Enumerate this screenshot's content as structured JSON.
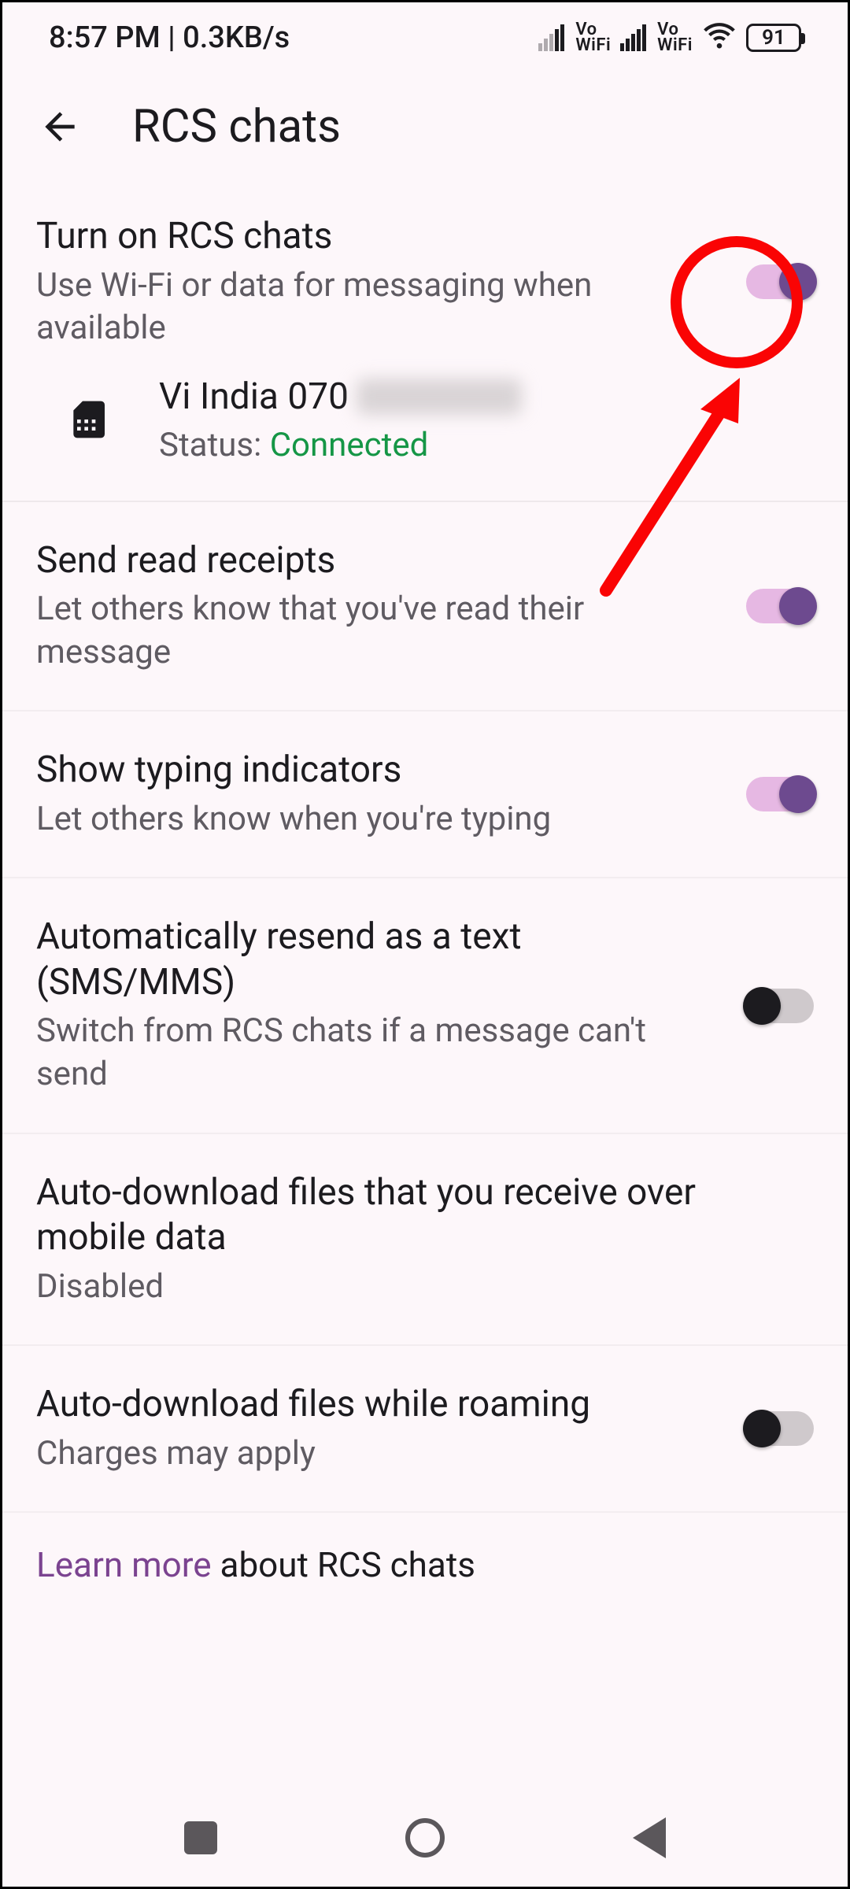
{
  "status_bar": {
    "time": "8:57 PM",
    "speed": "0.3KB/s",
    "vowifi1": "Vo\nWiFi",
    "vowifi2": "Vo\nWiFi",
    "battery": "91"
  },
  "header": {
    "title": "RCS chats"
  },
  "settings": {
    "rcs": {
      "title": "Turn on RCS chats",
      "subtitle": "Use Wi-Fi or data for messaging when available",
      "on": true
    },
    "sim": {
      "name_prefix": "Vi India 070",
      "status_label": "Status: ",
      "status_value": "Connected"
    },
    "read_receipts": {
      "title": "Send read receipts",
      "subtitle": "Let others know that you've read their message",
      "on": true
    },
    "typing": {
      "title": "Show typing indicators",
      "subtitle": "Let others know when you're typing",
      "on": true
    },
    "auto_resend": {
      "title": "Automatically resend as a text (SMS/MMS)",
      "subtitle": "Switch from RCS chats if a message can't send",
      "on": false
    },
    "auto_dl_mobile": {
      "title": "Auto-download files that you receive over mobile data",
      "subtitle": "Disabled"
    },
    "auto_dl_roaming": {
      "title": "Auto-download files while roaming",
      "subtitle": "Charges may apply",
      "on": false
    },
    "learn_more": {
      "link": "Learn more",
      "rest": " about RCS chats"
    }
  }
}
